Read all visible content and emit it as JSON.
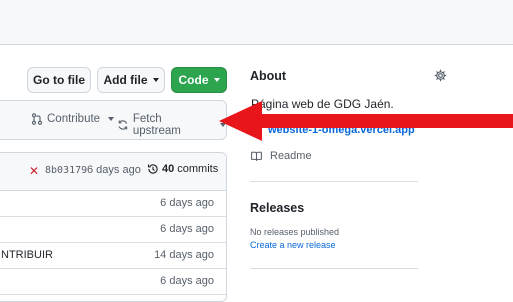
{
  "toolbar": {
    "go_to_file": "Go to file",
    "add_file": "Add file",
    "code": "Code"
  },
  "branch_bar": {
    "contribute": "Contribute",
    "fetch_upstream": "Fetch upstream"
  },
  "commit": {
    "status_icon": "✕",
    "sha": "8b03179",
    "age": "6 days ago",
    "count": "40",
    "count_label": "commits"
  },
  "files": [
    {
      "name": "",
      "age": "6 days ago"
    },
    {
      "name": "",
      "age": "6 days ago"
    },
    {
      "name": "NTRIBUIR",
      "age": "14 days ago"
    },
    {
      "name": "",
      "age": "6 days ago"
    }
  ],
  "about": {
    "title": "About",
    "description": "Página web de GDG Jaén.",
    "website": "website-1-omega.vercel.app",
    "readme": "Readme"
  },
  "releases": {
    "title": "Releases",
    "empty": "No releases published",
    "create": "Create a new release"
  },
  "colors": {
    "primary_green": "#2da44e",
    "link_blue": "#0969da",
    "annotation_arrow": "#e8151b",
    "error_red": "#cf222e"
  },
  "icons": [
    "gear-icon",
    "link-icon",
    "book-icon",
    "history-icon",
    "git-pull-request-icon",
    "sync-icon",
    "x-icon",
    "caret-down-icon"
  ]
}
